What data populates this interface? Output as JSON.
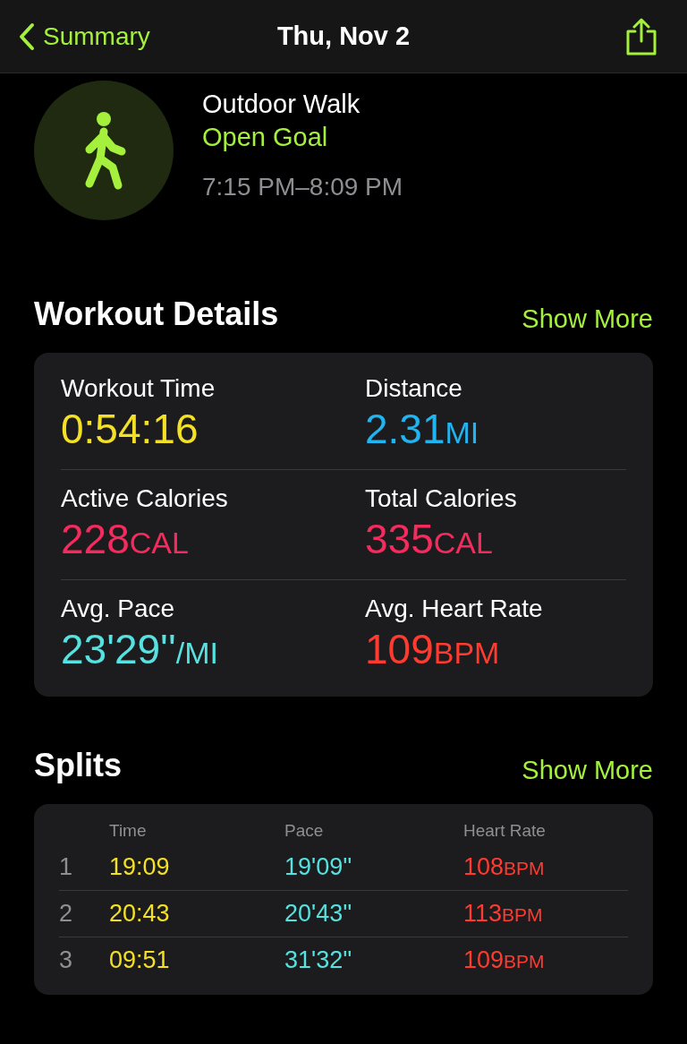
{
  "nav": {
    "back": "Summary",
    "title": "Thu, Nov 2"
  },
  "workout": {
    "name": "Outdoor Walk",
    "goal": "Open Goal",
    "time_range": "7:15 PM–8:09 PM"
  },
  "details": {
    "title": "Workout Details",
    "action": "Show More",
    "metrics": [
      {
        "label": "Workout Time",
        "value": "0:54:16",
        "color": "#f4e025"
      },
      {
        "label": "Distance",
        "value": "2.31",
        "unit": "MI",
        "color": "#20b5f0"
      },
      {
        "label": "Active Calories",
        "value": "228",
        "unit": "CAL",
        "color": "#f52a5d"
      },
      {
        "label": "Total Calories",
        "value": "335",
        "unit": "CAL",
        "color": "#f52a5d"
      },
      {
        "label": "Avg. Pace",
        "value": "23'29''",
        "unit": "/MI",
        "color": "#55e2e0"
      },
      {
        "label": "Avg. Heart Rate",
        "value": "109",
        "unit": "BPM",
        "color": "#ff3b30"
      }
    ]
  },
  "splits": {
    "title": "Splits",
    "action": "Show More",
    "columns": [
      "Time",
      "Pace",
      "Heart Rate"
    ],
    "rows": [
      {
        "index": "1",
        "time": "19:09",
        "pace": "19'09''",
        "heart_rate": "108",
        "unit": "BPM"
      },
      {
        "index": "2",
        "time": "20:43",
        "pace": "20'43''",
        "heart_rate": "113",
        "unit": "BPM"
      },
      {
        "index": "3",
        "time": "09:51",
        "pace": "31'32''",
        "heart_rate": "109",
        "unit": "BPM"
      }
    ]
  }
}
